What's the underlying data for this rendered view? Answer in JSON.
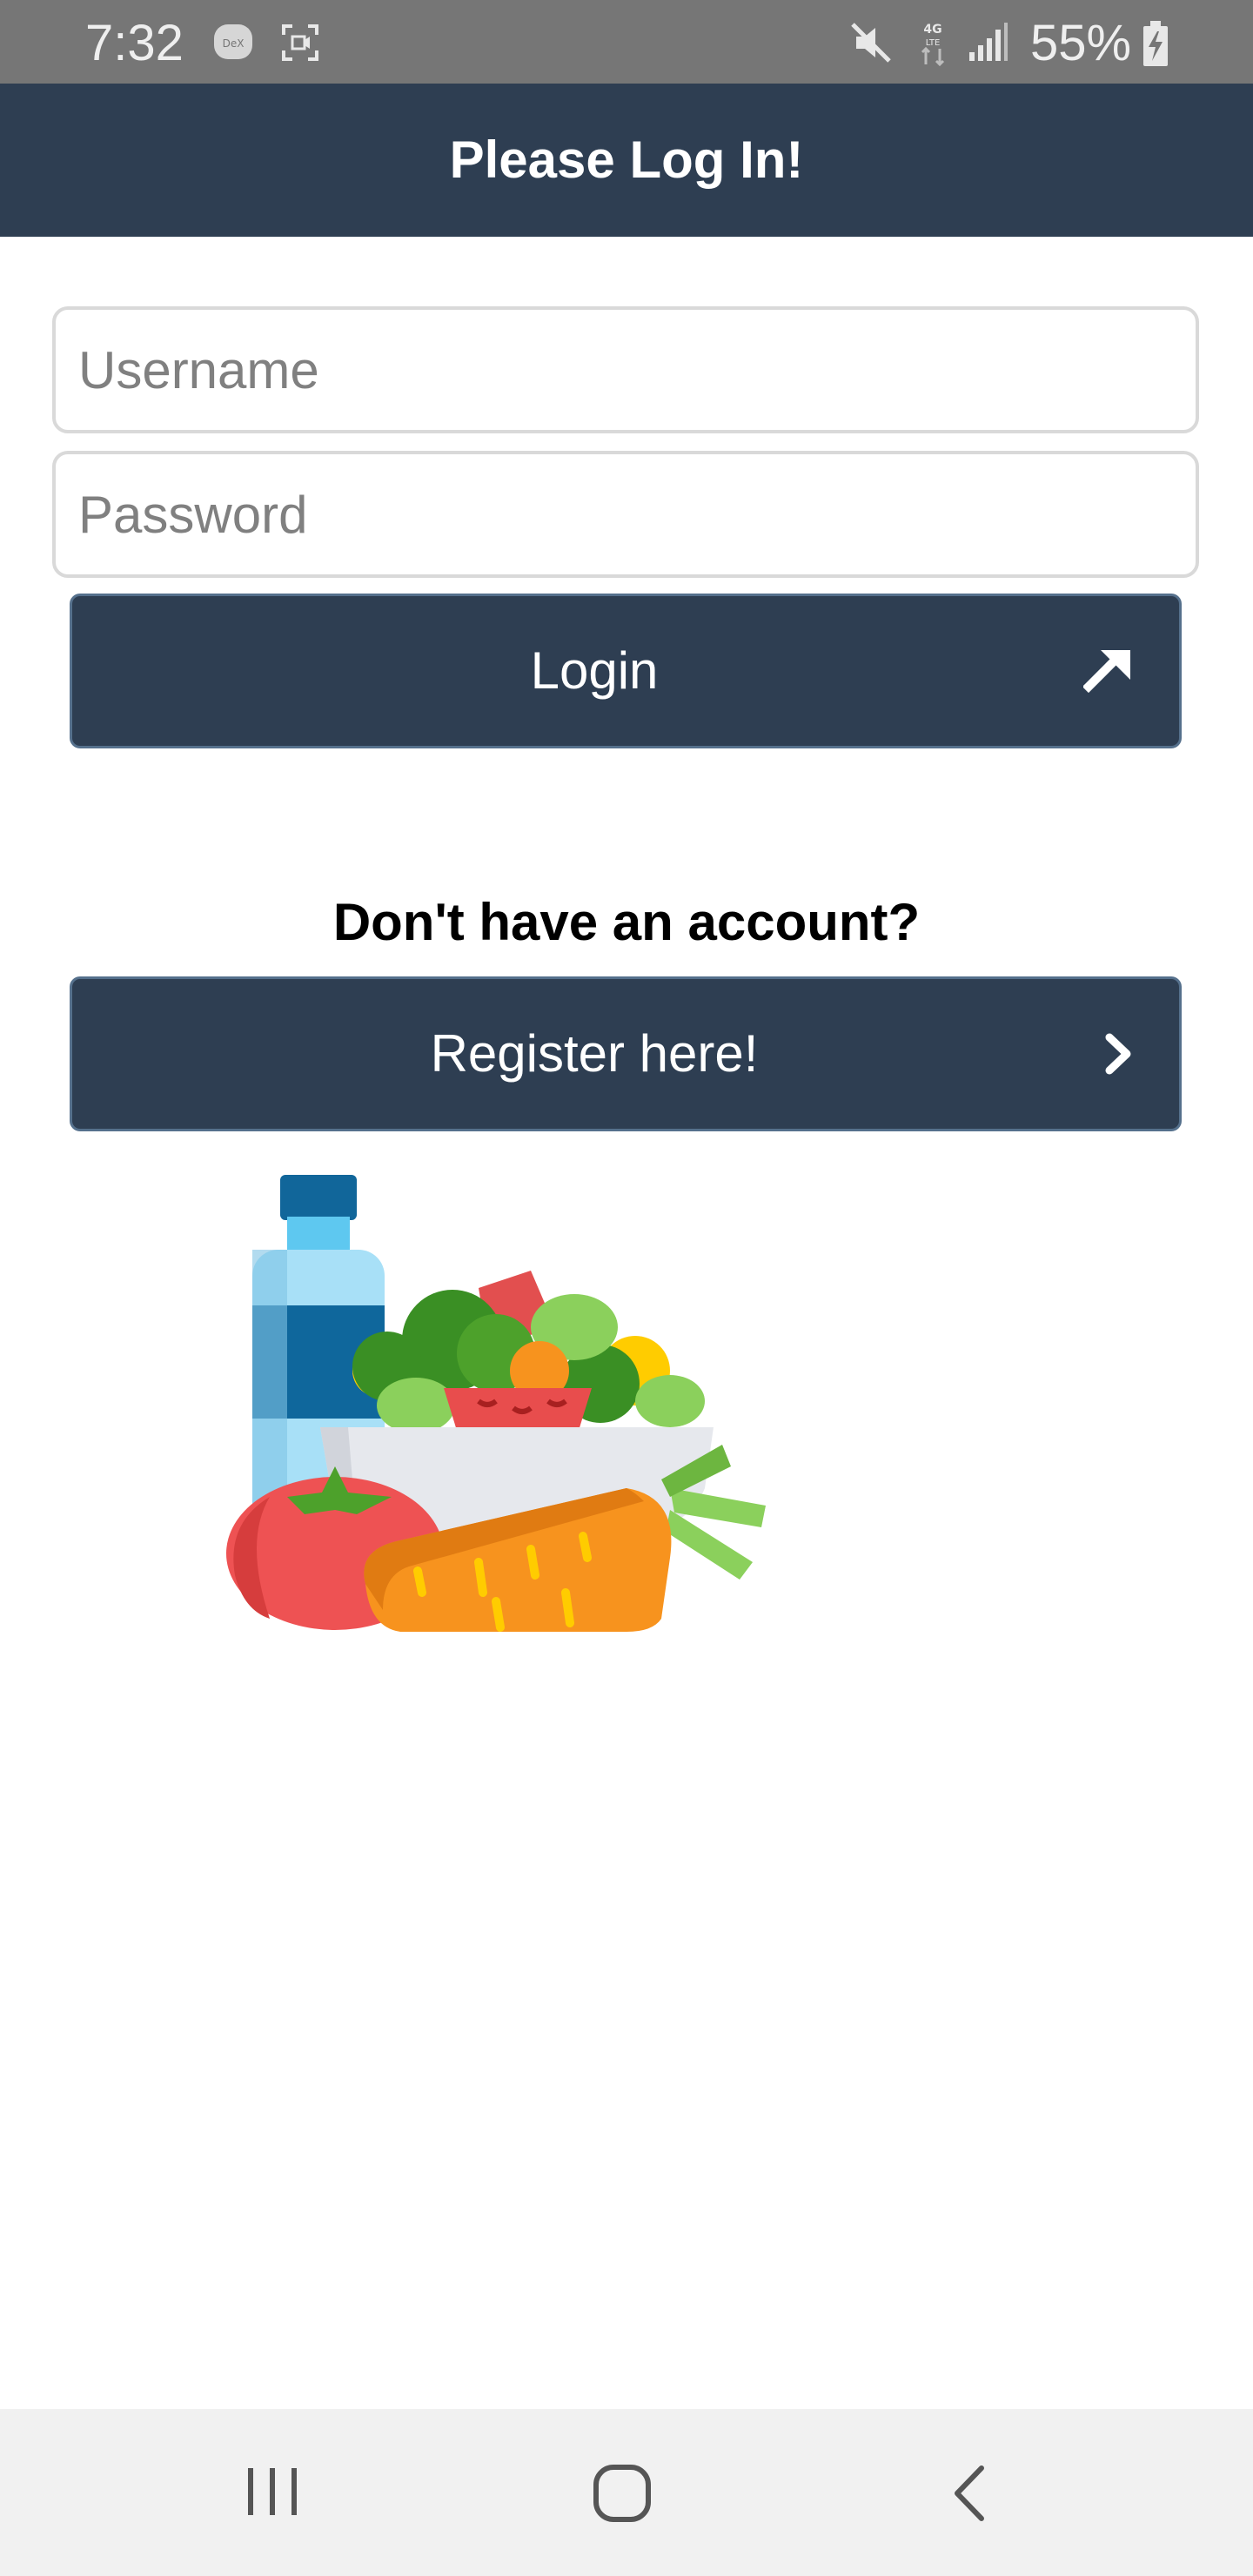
{
  "status_bar": {
    "time": "7:32",
    "battery": "55%",
    "icons": [
      "dex-icon",
      "screen-record-icon",
      "mute-icon",
      "lte-4g-icon",
      "signal-icon",
      "battery-charging-icon"
    ]
  },
  "header": {
    "title": "Please Log In!"
  },
  "form": {
    "username_placeholder": "Username",
    "username_value": "",
    "password_placeholder": "Password",
    "password_value": "",
    "login_label": "Login",
    "login_icon": "arrow-up-right-icon"
  },
  "register": {
    "question": "Don't have an account?",
    "button_label": "Register here!",
    "button_icon": "chevron-right-icon"
  },
  "illustration": {
    "name": "healthy-food-illustration",
    "items": [
      "water-bottle",
      "salad-bowl",
      "tomato",
      "carrot"
    ]
  },
  "nav_bar": {
    "buttons": [
      "recent-apps-icon",
      "home-icon",
      "back-icon"
    ]
  },
  "colors": {
    "primary": "#2e3e52",
    "status_bar": "#767676",
    "nav_bar": "#f1f1f1"
  }
}
